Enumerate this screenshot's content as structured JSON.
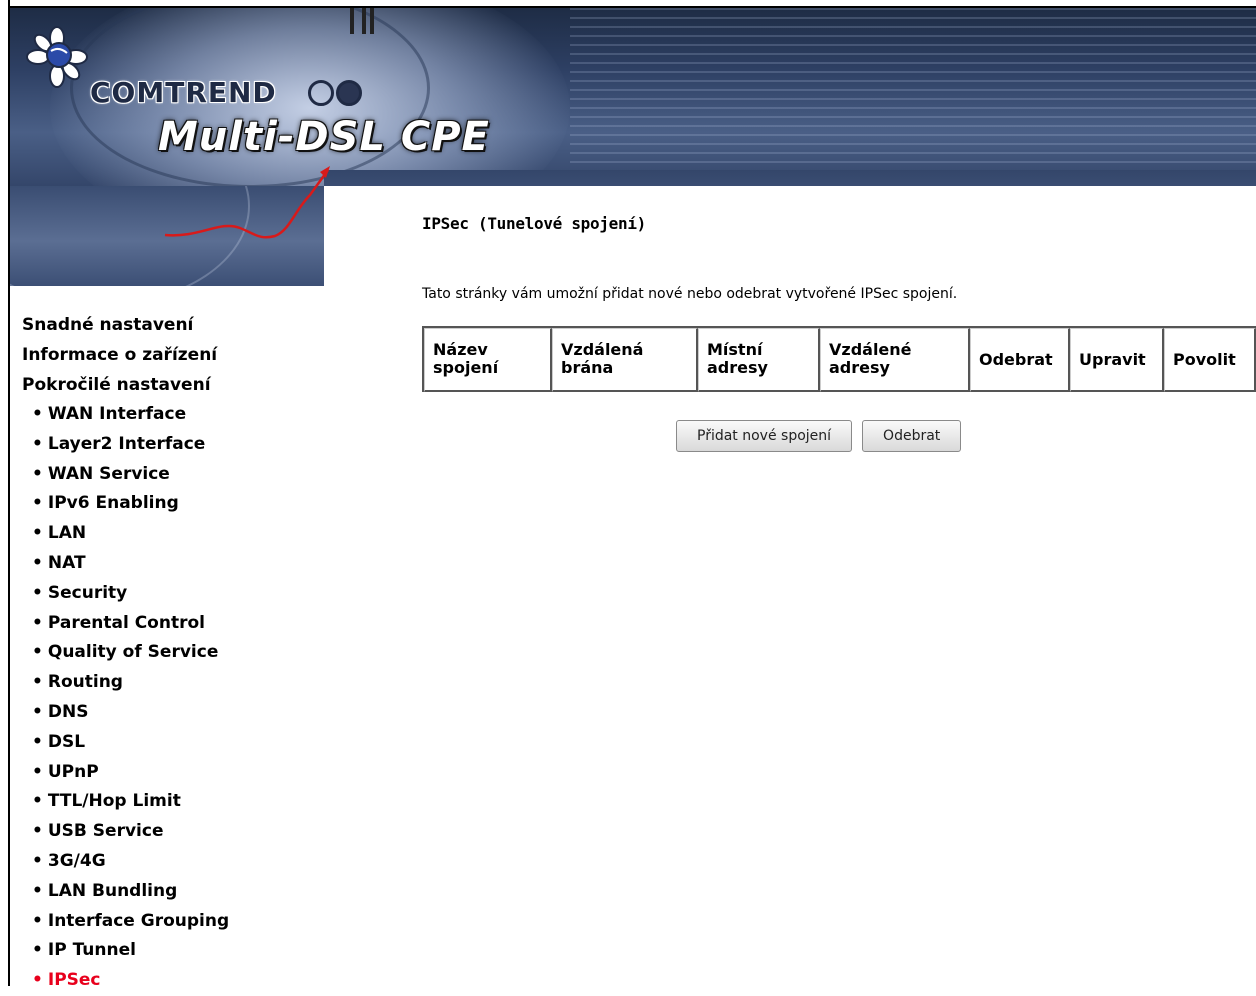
{
  "header": {
    "brand": "COMTREND",
    "product": "Multi-DSL CPE"
  },
  "nav": {
    "top_items": [
      "Snadné nastavení",
      "Informace o zařízení",
      "Pokročilé nastavení"
    ],
    "sub_items": [
      "WAN Interface",
      "Layer2 Interface",
      "WAN Service",
      "IPv6 Enabling",
      "LAN",
      "NAT",
      "Security",
      "Parental Control",
      "Quality of Service",
      "Routing",
      "DNS",
      "DSL",
      "UPnP",
      "TTL/Hop Limit",
      "USB Service",
      "3G/4G",
      "LAN Bundling",
      "Interface Grouping",
      "IP Tunnel",
      "IPSec"
    ],
    "active": "IPSec",
    "active_color": "#e8001c"
  },
  "main": {
    "title": "IPSec (Tunelové spojení)",
    "description": "Tato stránky vám umožní přidat nové nebo odebrat vytvořené IPSec spojení.",
    "table": {
      "headers": [
        "Název spojení",
        "Vzdálená brána",
        "Místní adresy",
        "Vzdálené adresy",
        "Odebrat",
        "Upravit",
        "Povolit"
      ],
      "rows": []
    },
    "buttons": {
      "add": "Přidat nové spojení",
      "remove": "Odebrat"
    }
  }
}
